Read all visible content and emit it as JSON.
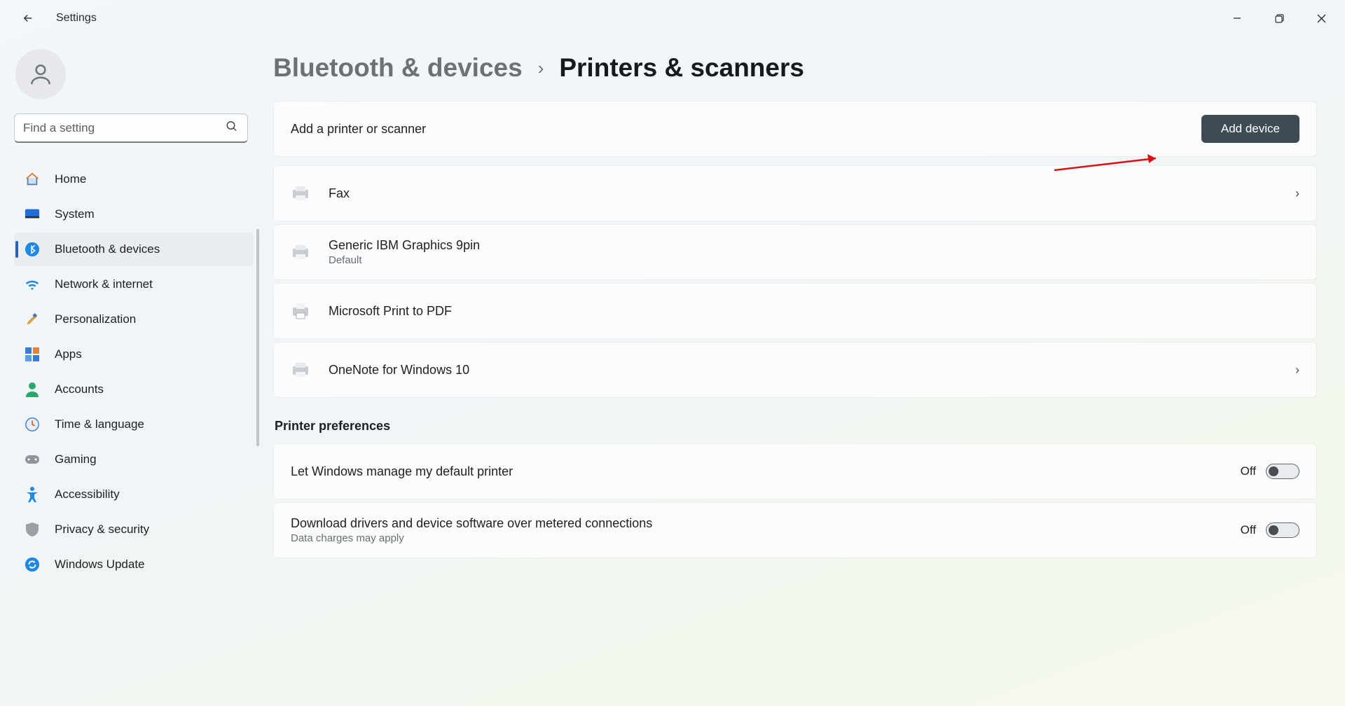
{
  "app_title": "Settings",
  "search": {
    "placeholder": "Find a setting"
  },
  "sidebar": {
    "items": [
      {
        "label": "Home"
      },
      {
        "label": "System"
      },
      {
        "label": "Bluetooth & devices"
      },
      {
        "label": "Network & internet"
      },
      {
        "label": "Personalization"
      },
      {
        "label": "Apps"
      },
      {
        "label": "Accounts"
      },
      {
        "label": "Time & language"
      },
      {
        "label": "Gaming"
      },
      {
        "label": "Accessibility"
      },
      {
        "label": "Privacy & security"
      },
      {
        "label": "Windows Update"
      }
    ]
  },
  "breadcrumb": {
    "parent": "Bluetooth & devices",
    "current": "Printers & scanners"
  },
  "add_card": {
    "label": "Add a printer or scanner",
    "button": "Add device"
  },
  "printers": [
    {
      "name": "Fax",
      "sub": ""
    },
    {
      "name": "Generic IBM Graphics 9pin",
      "sub": "Default"
    },
    {
      "name": "Microsoft Print to PDF",
      "sub": ""
    },
    {
      "name": "OneNote for Windows 10",
      "sub": ""
    }
  ],
  "preferences": {
    "title": "Printer preferences",
    "default_mgr": {
      "label": "Let Windows manage my default printer",
      "state": "Off"
    },
    "metered": {
      "label": "Download drivers and device software over metered connections",
      "sub": "Data charges may apply",
      "state": "Off"
    }
  }
}
